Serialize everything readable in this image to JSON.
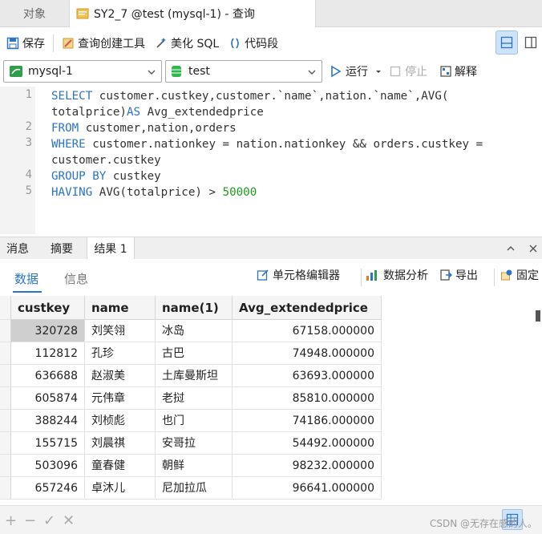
{
  "tabs": {
    "objects_label": "对象",
    "query_label": "SY2_7 @test (mysql-1) - 查询"
  },
  "toolbar": {
    "save_label": "保存",
    "query_builder_label": "查询创建工具",
    "beautify_label": "美化 SQL",
    "snippet_label": "代码段"
  },
  "connection": {
    "connection_value": "mysql-1",
    "database_value": "test",
    "run_label": "运行",
    "stop_label": "停止",
    "explain_label": "解释"
  },
  "editor": {
    "line_numbers": [
      "1",
      "2",
      "3",
      "4",
      "5"
    ],
    "lines": [
      {
        "kw1": "SELECT",
        "text1": " customer.custkey,customer.`name`,nation.`name`,AVG("
      },
      {
        "text1": "totalprice)",
        "kw1": "AS",
        "text2": " Avg_extendedprice"
      },
      {
        "kw1": "FROM",
        "text1": " customer,nation,orders"
      },
      {
        "kw1": "WHERE",
        "text1": " customer.nationkey = nation.nationkey && orders.custkey ="
      },
      {
        "text1": "customer.custkey"
      },
      {
        "kw1": "GROUP BY",
        "text1": " custkey"
      },
      {
        "kw1": "HAVING",
        "text1": " AVG(totalprice) > ",
        "num": "50000"
      }
    ]
  },
  "results": {
    "tabs": [
      "消息",
      "摘要",
      "结果 1"
    ],
    "sub_tabs": [
      "数据",
      "信息"
    ],
    "cell_editor_label": "单元格编辑器",
    "data_analysis_label": "数据分析",
    "export_label": "导出",
    "pin_label": "固定",
    "columns": [
      "custkey",
      "name",
      "name(1)",
      "Avg_extendedprice"
    ],
    "rows": [
      [
        "320728",
        "刘笑翎",
        "冰岛",
        "67158.000000"
      ],
      [
        "112812",
        "孔珍",
        "古巴",
        "74948.000000"
      ],
      [
        "636688",
        "赵淑美",
        "土库曼斯坦",
        "63693.000000"
      ],
      [
        "605874",
        "元伟章",
        "老挝",
        "85810.000000"
      ],
      [
        "388244",
        "刘桢彪",
        "也门",
        "74186.000000"
      ],
      [
        "155715",
        "刘晨祺",
        "安哥拉",
        "54492.000000"
      ],
      [
        "503096",
        "童春健",
        "朝鲜",
        "98232.000000"
      ],
      [
        "657246",
        "卓沐儿",
        "尼加拉瓜",
        "96641.000000"
      ]
    ]
  },
  "bottom": {
    "add_icon": "+",
    "remove_icon": "−",
    "apply_icon": "✓",
    "discard_icon": "✕",
    "watermark": "CSDN @无存在感的人。"
  },
  "colors": {
    "keyword": "#2b74c7",
    "number": "#1c9c1c",
    "accent": "#2b74c7"
  }
}
